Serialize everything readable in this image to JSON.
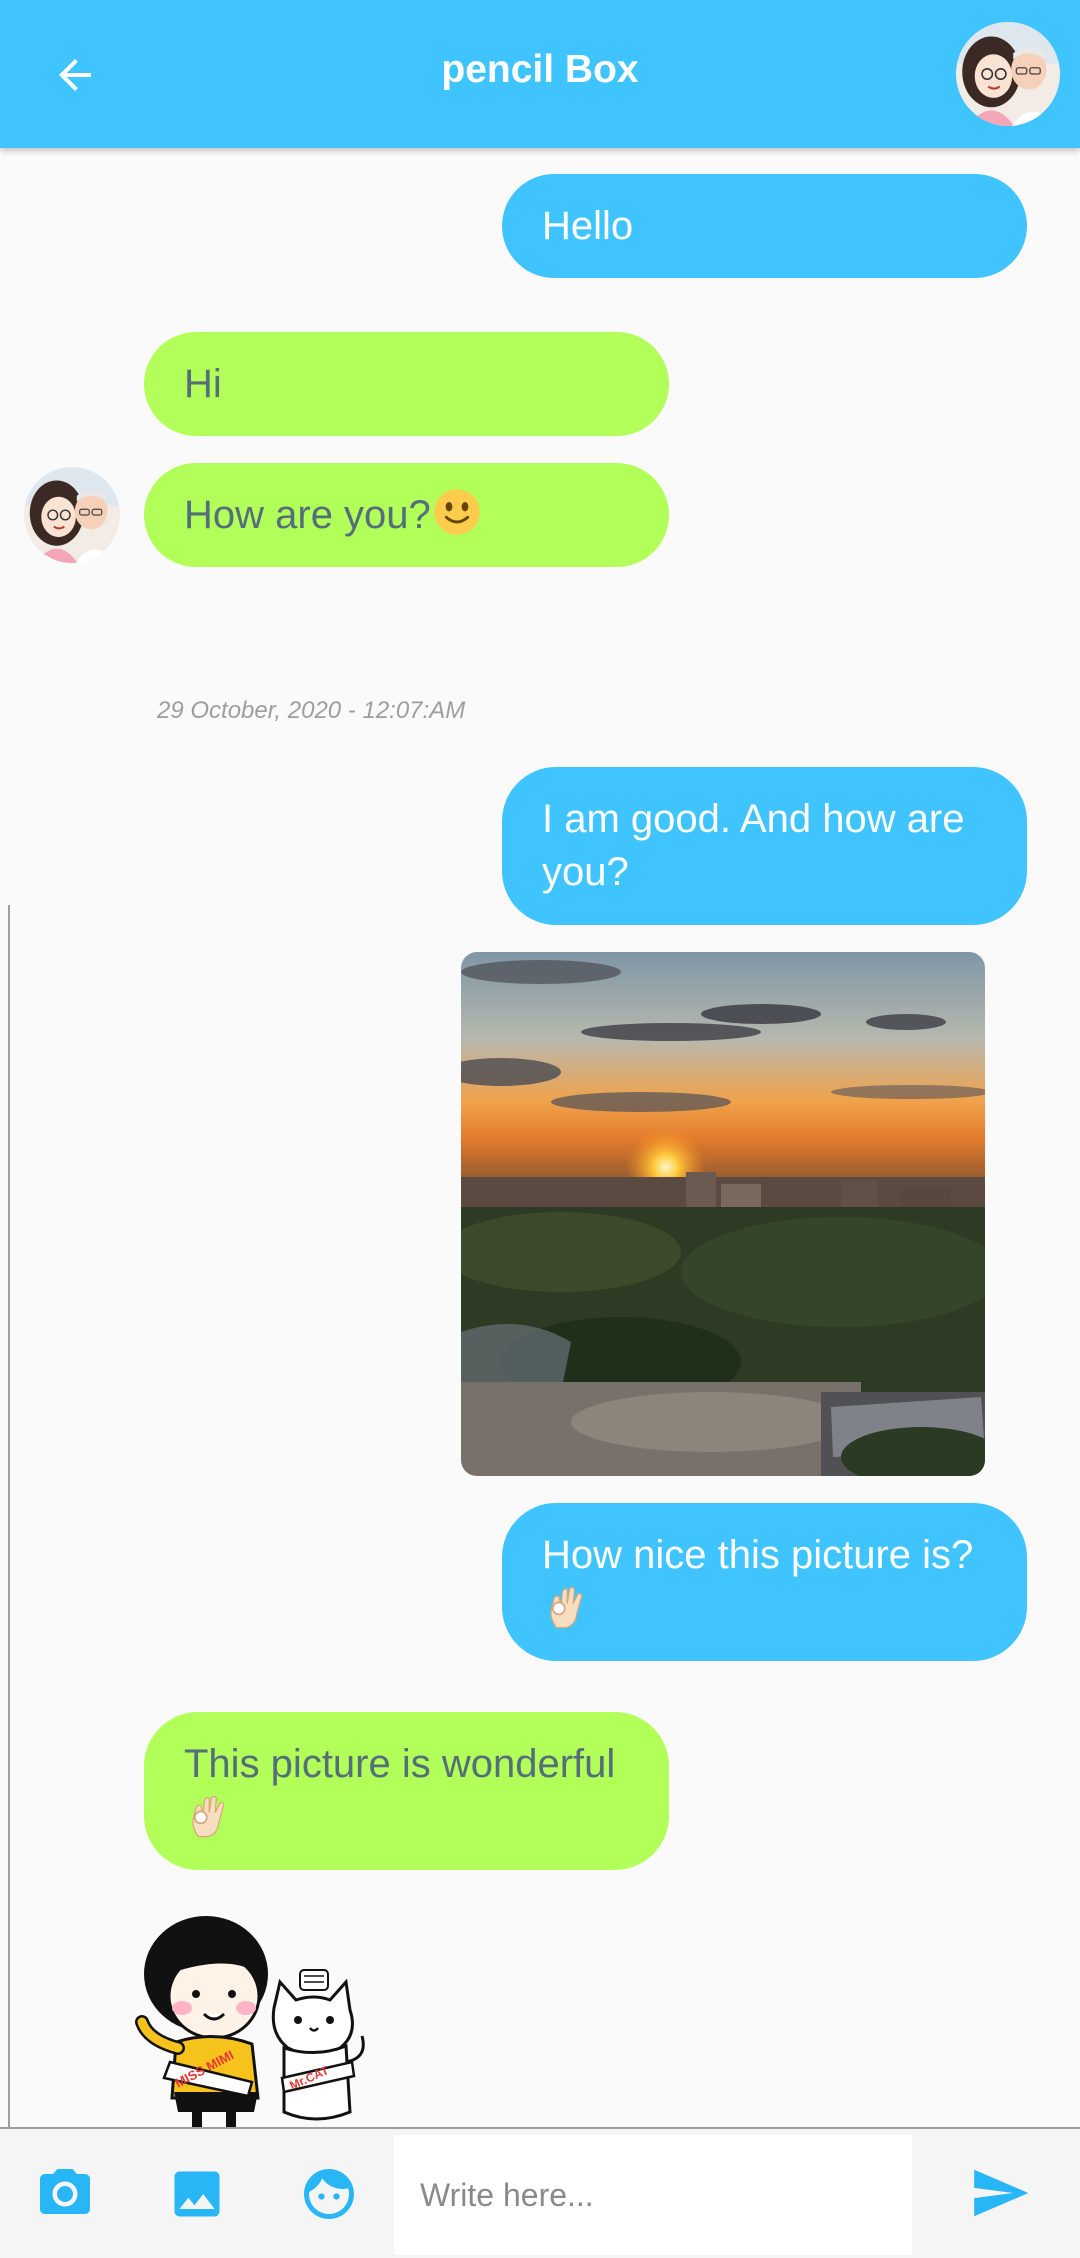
{
  "header": {
    "title": "pencil Box",
    "back_icon": "arrow-back-icon",
    "avatar": "contact-avatar"
  },
  "messages": [
    {
      "side": "me",
      "text": "Hello"
    },
    {
      "side": "peer",
      "text": "Hi"
    },
    {
      "side": "peer",
      "text": "How are you?",
      "emoji": "slightly-smiling-face"
    },
    {
      "type": "timestamp",
      "text": "29 October, 2020 - 12:07:AM"
    },
    {
      "side": "me",
      "text": "I am good. And how are you?"
    },
    {
      "side": "me",
      "type": "image",
      "image": "sunset-city-photo"
    },
    {
      "side": "me",
      "text": "How nice this picture is?",
      "emoji": "ok-hand"
    },
    {
      "side": "peer",
      "text": "This picture is wonderful",
      "emoji": "ok-hand"
    },
    {
      "side": "peer",
      "type": "sticker",
      "sticker": "miss-mimi-and-mr-cat",
      "sticker_text": [
        "MISS MIMI",
        "Mr.CAT"
      ]
    }
  ],
  "input_bar": {
    "camera_icon": "camera-icon",
    "gallery_icon": "image-icon",
    "sticker_icon": "face-icon",
    "placeholder": "Write here...",
    "value": "",
    "send_icon": "send-icon"
  },
  "colors": {
    "primary": "#40c4ff",
    "my_bubble": "#40c4ff",
    "peer_bubble": "#b2ff59",
    "peer_text": "#546e7a",
    "timestamp": "#9e9e9e",
    "background": "#fafafa"
  }
}
